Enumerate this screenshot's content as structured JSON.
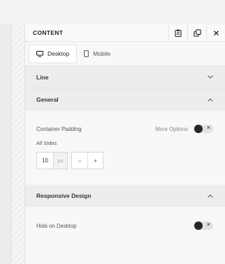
{
  "panel": {
    "title": "CONTENT",
    "header_icons": [
      "clipboard-icon",
      "duplicate-icon",
      "close-icon"
    ]
  },
  "tabs": [
    {
      "label": "Desktop",
      "icon": "monitor-icon",
      "active": true
    },
    {
      "label": "Mobile",
      "icon": "phone-icon",
      "active": false
    }
  ],
  "sections": {
    "line": {
      "title": "Line",
      "expanded": false
    },
    "general": {
      "title": "General",
      "expanded": true,
      "container_padding_label": "Container Padding",
      "more_options_label": "More Options",
      "all_sides_label": "All Sides",
      "padding_value": "10",
      "padding_unit": "px",
      "decrement": "−",
      "increment": "+"
    },
    "responsive": {
      "title": "Responsive Design",
      "expanded": true,
      "hide_on_desktop_label": "Hide on Desktop"
    }
  },
  "glyphs": {
    "toggle_x": "×"
  }
}
